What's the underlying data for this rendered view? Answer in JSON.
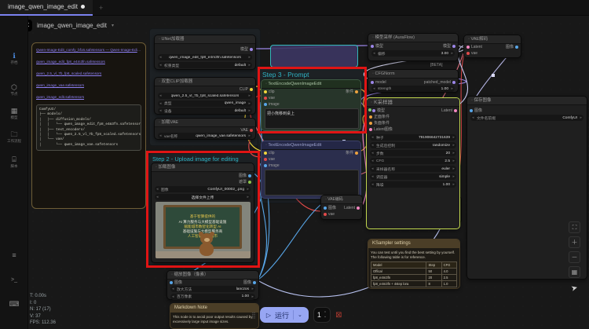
{
  "tabbar": {
    "tab_label": "image_qwen_image_edit",
    "new_tab_glyph": "+"
  },
  "menubar": {
    "logo_glyph": "C",
    "workflow_title": "image_qwen_image_edit",
    "caret": "▾"
  },
  "sidebar": {
    "items": [
      {
        "glyph": "ℹ",
        "label": "存档"
      },
      {
        "glyph": "⬡",
        "label": "节点"
      },
      {
        "glyph": "▦",
        "label": "模型"
      },
      {
        "glyph": "🗀",
        "label": "工作流程"
      },
      {
        "glyph": "⌸",
        "label": "脚本"
      }
    ],
    "bottom": [
      {
        "glyph": "≡",
        "name": "logs"
      },
      {
        "glyph": ">_",
        "name": "terminal"
      },
      {
        "glyph": "⌨",
        "name": "shortcuts"
      }
    ]
  },
  "groups": {
    "step2_title": "Step 2 - Upload image for editing",
    "step3_title": "Step 3 - Prompt"
  },
  "notes": {
    "models_note": {
      "links": [
        "Qwen-Image-Edit_comfy_bf16.safetensors — Qwen-Image-Edit_comfy_fp8.safetensors",
        "qwen_image_edit_fp8_e4m3fn.safetensors",
        "qwen_2.5_vl_7b_fp8_scaled.safetensors",
        "qwen_image_vae.safetensors",
        "qwen_image_edit.safetensors"
      ],
      "tree": "ComfyUI/\n├── models/\n│   ├── diffusion_models/\n│   │   └── qwen_image_edit_fp8_e4m3fn.safetensors\n│   ├── text_encoders/\n│   │   └── qwen_2.5_vl_7b_fp8_scaled.safetensors\n│   └── vae/\n│       └── qwen_image_vae.safetensors"
    },
    "ksampler_note": {
      "title": "KSampler settings",
      "body": "You can test until you find the best setting by yourself. The following table is for reference.",
      "table": {
        "headers": [
          "Model",
          "Step",
          "CFG"
        ],
        "rows": [
          [
            "Offical",
            "50",
            "4.0"
          ],
          [
            "fp8_e4m3fn",
            "20",
            "2.5"
          ],
          [
            "fp8_e4m3fn + 4step lora",
            "8",
            "1.0"
          ]
        ]
      }
    },
    "markdown_note": {
      "title": "Markdown Note",
      "body": "This node is to avoid poor output results caused by excessively large input image sizes."
    }
  },
  "nodes": {
    "unet": {
      "title": "UNet加载器",
      "out": "模型",
      "w1": "qwen_image_edit_fp8_e4m3fn.safetensors",
      "w2l": "权重类型",
      "w2v": "default"
    },
    "dualclip": {
      "title": "双重CLIP加载器",
      "out": "CLIP",
      "w1": "qwen_2.5_vl_7b_fp8_scaled.safetensors",
      "w2l": "类型",
      "w2v": "qwen_image",
      "w3l": "设备",
      "w3v": "default"
    },
    "vae": {
      "title": "加载VAE",
      "out": "VAE",
      "w1l": "vae名称",
      "w1v": "qwen_image_vae.safetensors"
    },
    "pos_encode": {
      "title": "TextEncodeQwenImageEdit",
      "in1": "clip",
      "in2": "vae",
      "in3": "image",
      "out": "条件",
      "text": "把小熊移到桌上"
    },
    "neg_encode": {
      "title": "TextEncodeQwenImageEdit",
      "in1": "clip",
      "in2": "vae",
      "in3": "image",
      "out": "条件",
      "text": ""
    },
    "load_image": {
      "title": "加载图像",
      "out1": "图像",
      "out2": "遮罩",
      "w1l": "图像",
      "w1v": "ComfyUI_00002_.png",
      "btn": "选择文件上传"
    },
    "scale_image": {
      "title": "缩放图像（像素）",
      "in1": "图像",
      "out": "图像",
      "w1l": "放大方法",
      "w1v": "lanczos",
      "w2l": "百万像素",
      "w2v": "1.00"
    },
    "vae_encode": {
      "title": "VAE编码",
      "in1": "图像",
      "in2": "vae",
      "out": "Latent"
    },
    "model_sampling": {
      "title": "模型采样 (AuraFlow)",
      "in1": "模型",
      "out": "模型",
      "w1l": "偏移",
      "w1v": "3.00",
      "beta": "[BETA]"
    },
    "cfgnorm": {
      "title": "CFGNorm",
      "in1": "model",
      "out": "patched_model",
      "w1l": "strength",
      "w1v": "1.00"
    },
    "ksampler": {
      "title": "K采样器",
      "in1": "模型",
      "in2": "正面条件",
      "in3": "负面条件",
      "in4": "Latent图像",
      "out": "Latent",
      "w1l": "种子",
      "w1v": "791906642731639",
      "w2l": "生成后控制",
      "w2v": "randomize",
      "w3l": "步数",
      "w3v": "20",
      "w4l": "CFG",
      "w4v": "2.5",
      "w5l": "采样器名称",
      "w5v": "euler",
      "w6l": "调度器",
      "w6v": "simple",
      "w7l": "降噪",
      "w7v": "1.00"
    },
    "vae_decode": {
      "title": "VAE解码",
      "in1": "Latent",
      "in2": "vae",
      "out": "图像"
    },
    "save_image": {
      "title": "保存图像",
      "in1": "图像",
      "w1l": "文件名前缀",
      "w1v": "ComfyUI"
    }
  },
  "blackboard": {
    "lines": [
      "基于智算提供的",
      "AI 算力服务与大模型基础设施",
      "赋能城市数智化转型 AI",
      "基础设施与大模型服务商",
      "人工智能 赋能城市"
    ]
  },
  "runbar": {
    "run_label": "运行",
    "count": "1"
  },
  "stats": {
    "l1": "T: 0.00s",
    "l2": "I: 0",
    "l3": "N: 17 (17)",
    "l4": "V: 37",
    "l5": "FPS: 112.36"
  },
  "rtool": {
    "b1": "⛶",
    "b2": "＋",
    "b3": "－",
    "b4": "▦",
    "pointer": "➤"
  },
  "colors": {
    "model": "#9c86e8",
    "clip": "#f0d63c",
    "vae": "#e24a4a",
    "image": "#58a6e8",
    "mask": "#8bc34a",
    "cond": "#eda23f",
    "latent": "#f387c0",
    "accent_run": "#97a6f3",
    "annotation": "#e01414"
  }
}
